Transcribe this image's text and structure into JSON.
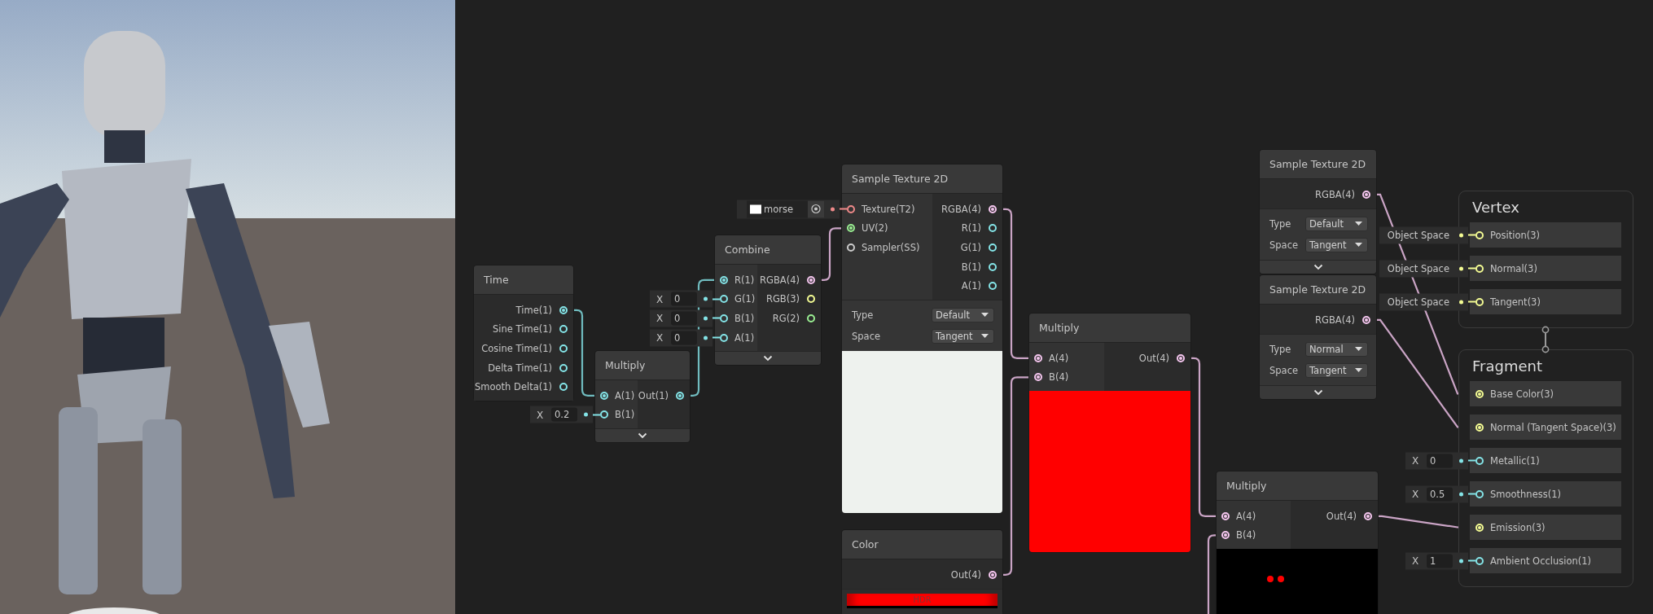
{
  "nodes": [
    {
      "title": "Time",
      "outputs": [
        {
          "label": "Time(1)",
          "color": "#84e4e7",
          "connected": true
        },
        {
          "label": "Sine Time(1)",
          "color": "#84e4e7",
          "connected": false
        },
        {
          "label": "Cosine Time(1)",
          "color": "#84e4e7",
          "connected": false
        },
        {
          "label": "Delta Time(1)",
          "color": "#84e4e7",
          "connected": false
        },
        {
          "label": "Smooth Delta(1)",
          "color": "#84e4e7",
          "connected": false
        }
      ]
    },
    {
      "title": "Multiply",
      "inputs": [
        {
          "label": "A(1)",
          "color": "#84e4e7",
          "connected": true
        },
        {
          "label": "B(1)",
          "color": "#84e4e7",
          "connected": false,
          "default": {
            "label": "X",
            "value": "0.2"
          }
        }
      ],
      "outputs": [
        {
          "label": "Out(1)",
          "color": "#84e4e7",
          "connected": true
        }
      ],
      "expand_toggle": true
    },
    {
      "title": "Combine",
      "inputs": [
        {
          "label": "R(1)",
          "color": "#84e4e7",
          "connected": true
        },
        {
          "label": "G(1)",
          "color": "#84e4e7",
          "connected": false,
          "default": {
            "label": "X",
            "value": "0"
          }
        },
        {
          "label": "B(1)",
          "color": "#84e4e7",
          "connected": false,
          "default": {
            "label": "X",
            "value": "0"
          }
        },
        {
          "label": "A(1)",
          "color": "#84e4e7",
          "connected": false,
          "default": {
            "label": "X",
            "value": "0"
          }
        }
      ],
      "outputs": [
        {
          "label": "RGBA(4)",
          "color": "#f5c6ef",
          "connected": true
        },
        {
          "label": "RGB(3)",
          "color": "#f3fb93",
          "connected": false
        },
        {
          "label": "RG(2)",
          "color": "#9aef92",
          "connected": false
        }
      ],
      "expand_toggle": true
    },
    {
      "title": "Sample Texture 2D",
      "inputs": [
        {
          "label": "Texture(T2)",
          "color": "#f08a8a",
          "connected": false,
          "texture": {
            "value": "morse"
          }
        },
        {
          "label": "UV(2)",
          "color": "#9aef92",
          "connected": true
        },
        {
          "label": "Sampler(SS)",
          "color": "#cbcbcb",
          "connected": false
        }
      ],
      "outputs": [
        {
          "label": "RGBA(4)",
          "color": "#f5c6ef",
          "connected": true
        },
        {
          "label": "R(1)",
          "color": "#84e4e7",
          "connected": false
        },
        {
          "label": "G(1)",
          "color": "#84e4e7",
          "connected": false
        },
        {
          "label": "B(1)",
          "color": "#84e4e7",
          "connected": false
        },
        {
          "label": "A(1)",
          "color": "#84e4e7",
          "connected": false
        }
      ],
      "settings": [
        {
          "label": "Type",
          "value": "Default"
        },
        {
          "label": "Space",
          "value": "Tangent"
        }
      ],
      "preview": {
        "kind": "white"
      }
    },
    {
      "title": "Color",
      "outputs": [
        {
          "label": "Out(4)",
          "color": "#f5c6ef",
          "connected": true
        }
      ],
      "swatch": {
        "label": "HDR",
        "color": "#ff0000"
      }
    },
    {
      "title": "Multiply",
      "inputs": [
        {
          "label": "A(4)",
          "color": "#f5c6ef",
          "connected": true
        },
        {
          "label": "B(4)",
          "color": "#f5c6ef",
          "connected": true
        }
      ],
      "outputs": [
        {
          "label": "Out(4)",
          "color": "#f5c6ef",
          "connected": true
        }
      ],
      "preview": {
        "kind": "red"
      }
    },
    {
      "title": "Sample Texture 2D",
      "outputs": [
        {
          "label": "RGBA(4)",
          "color": "#f5c6ef",
          "connected": true
        }
      ],
      "settings": [
        {
          "label": "Type",
          "value": "Default"
        },
        {
          "label": "Space",
          "value": "Tangent"
        }
      ],
      "expand_toggle": true
    },
    {
      "title": "Sample Texture 2D",
      "outputs": [
        {
          "label": "RGBA(4)",
          "color": "#f5c6ef",
          "connected": true
        }
      ],
      "settings": [
        {
          "label": "Type",
          "value": "Normal"
        },
        {
          "label": "Space",
          "value": "Tangent"
        }
      ],
      "expand_toggle": true
    },
    {
      "title": "Multiply",
      "inputs": [
        {
          "label": "A(4)",
          "color": "#f5c6ef",
          "connected": true
        },
        {
          "label": "B(4)",
          "color": "#f5c6ef",
          "connected": true
        }
      ],
      "outputs": [
        {
          "label": "Out(4)",
          "color": "#f5c6ef",
          "connected": true
        }
      ],
      "preview": {
        "kind": "dots"
      }
    }
  ],
  "contexts": [
    {
      "title": "Vertex",
      "blocks": [
        {
          "label": "Position(3)",
          "color": "#f3fb93",
          "connected": false,
          "default": {
            "value": "Object Space"
          }
        },
        {
          "label": "Normal(3)",
          "color": "#f3fb93",
          "connected": false,
          "default": {
            "value": "Object Space"
          }
        },
        {
          "label": "Tangent(3)",
          "color": "#f3fb93",
          "connected": false,
          "default": {
            "value": "Object Space"
          }
        }
      ]
    },
    {
      "title": "Fragment",
      "blocks": [
        {
          "label": "Base Color(3)",
          "color": "#f3fb93",
          "connected": true
        },
        {
          "label": "Normal (Tangent Space)(3)",
          "color": "#f3fb93",
          "connected": true
        },
        {
          "label": "Metallic(1)",
          "color": "#84e4e7",
          "connected": false,
          "default": {
            "label": "X",
            "value": "0"
          }
        },
        {
          "label": "Smoothness(1)",
          "color": "#84e4e7",
          "connected": false,
          "default": {
            "label": "X",
            "value": "0.5"
          }
        },
        {
          "label": "Emission(3)",
          "color": "#f3fb93",
          "connected": true
        },
        {
          "label": "Ambient Occlusion(1)",
          "color": "#84e4e7",
          "connected": false,
          "default": {
            "label": "X",
            "value": "1"
          }
        }
      ]
    }
  ]
}
